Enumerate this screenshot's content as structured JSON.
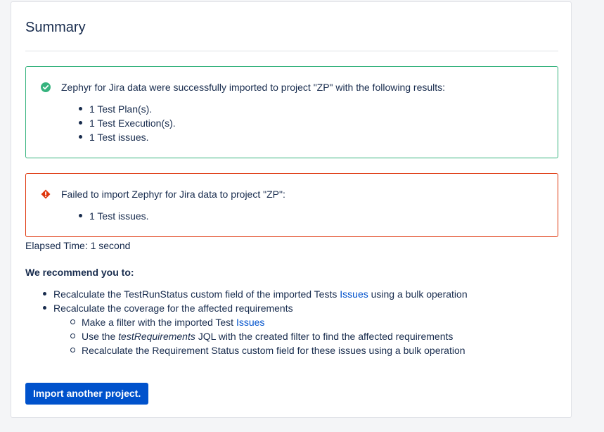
{
  "summary": {
    "title": "Summary"
  },
  "success_panel": {
    "icon": "check-circle-icon",
    "color": "#36b37e",
    "message": "Zephyr for Jira data were successfully imported to project \"ZP\" with the following results:",
    "items": [
      "1 Test Plan(s).",
      "1 Test Execution(s).",
      "1 Test issues."
    ]
  },
  "error_panel": {
    "icon": "error-diamond-icon",
    "color": "#de350b",
    "message": "Failed to import Zephyr for Jira data to project \"ZP\":",
    "items": [
      "1 Test issues."
    ]
  },
  "elapsed": {
    "text": "Elapsed Time: 1 second"
  },
  "recommendations": {
    "title": "We recommend you to:",
    "item1": {
      "before": "Recalculate the TestRunStatus custom field of the imported Tests ",
      "link": "Issues",
      "after": " using a bulk operation"
    },
    "item2": {
      "text": "Recalculate the coverage for the affected requirements",
      "sub1": {
        "before": "Make a filter with the imported Test ",
        "link": "Issues"
      },
      "sub2": {
        "before": "Use the ",
        "italic": "testRequirements",
        "after": " JQL with the created filter to find the affected requirements"
      },
      "sub3": {
        "text": "Recalculate the Requirement Status custom field for these issues using a bulk operation"
      }
    }
  },
  "actions": {
    "import_another_label": "Import another project."
  },
  "colors": {
    "primary": "#0052cc",
    "text": "#172b4d",
    "border": "#dfe1e6"
  }
}
